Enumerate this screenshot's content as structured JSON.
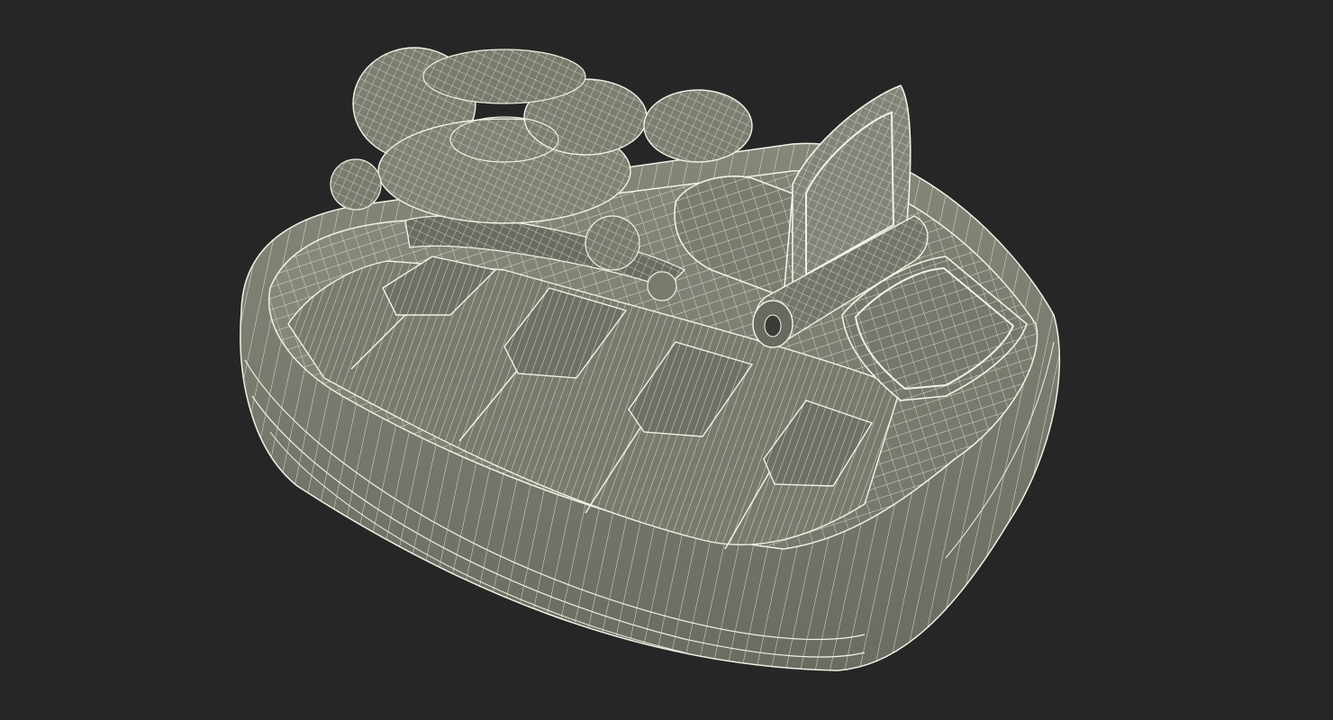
{
  "scene": {
    "background_color": "#262626",
    "surface_color": "#7d7d72",
    "surface_shadow_color": "#5f5f56",
    "surface_light_color": "#8c8c80",
    "wire_color": "#f2f2e4"
  }
}
